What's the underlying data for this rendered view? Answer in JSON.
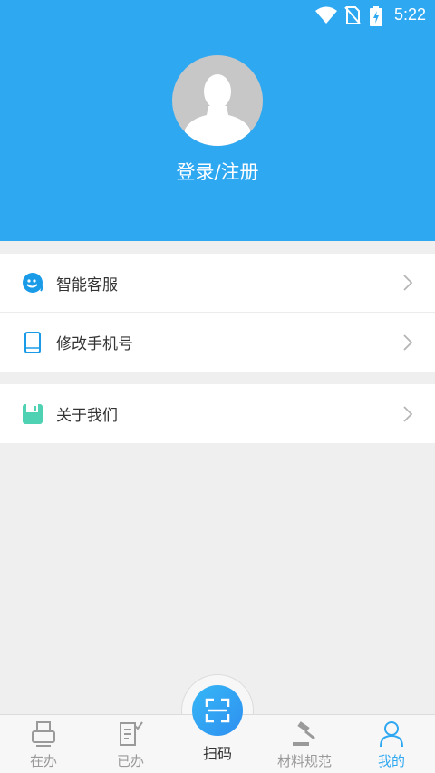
{
  "status_bar": {
    "time": "5:22",
    "icons": [
      "wifi-icon",
      "no-sim-icon",
      "battery-charging-icon"
    ]
  },
  "profile": {
    "login_label": "登录/注册",
    "avatar_icon": "default-avatar-icon"
  },
  "menu": {
    "group1": [
      {
        "label": "智能客服",
        "icon": "customer-service-icon"
      },
      {
        "label": "修改手机号",
        "icon": "phone-icon"
      }
    ],
    "group2": [
      {
        "label": "关于我们",
        "icon": "about-icon"
      }
    ]
  },
  "tabbar": {
    "tabs": [
      {
        "label": "在办",
        "icon": "printer-icon",
        "active": false
      },
      {
        "label": "已办",
        "icon": "checklist-icon",
        "active": false
      },
      {
        "label": "扫码",
        "icon": "scan-icon",
        "active": false
      },
      {
        "label": "材料规范",
        "icon": "gavel-icon",
        "active": false
      },
      {
        "label": "我的",
        "icon": "user-icon",
        "active": true
      }
    ]
  },
  "colors": {
    "accent": "#2fa8f2",
    "background": "#efefef",
    "tab_inactive": "#9a9a9a"
  }
}
